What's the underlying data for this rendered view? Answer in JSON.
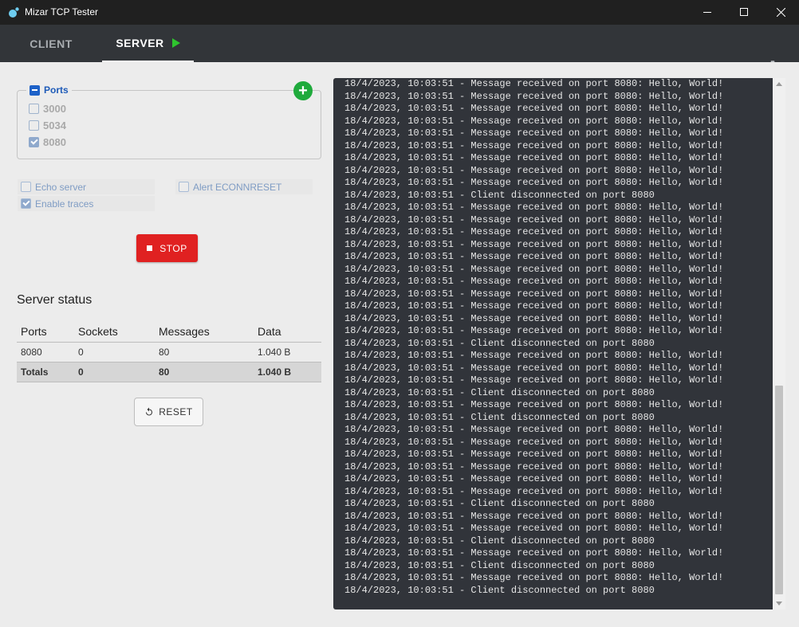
{
  "window": {
    "title": "Mizar TCP Tester"
  },
  "tabs": {
    "client": "CLIENT",
    "server": "SERVER"
  },
  "ports": {
    "legend": "Ports",
    "items": [
      {
        "label": "3000",
        "checked": false
      },
      {
        "label": "5034",
        "checked": false
      },
      {
        "label": "8080",
        "checked": true
      }
    ]
  },
  "options": {
    "echo_server": "Echo server",
    "enable_traces": "Enable traces",
    "alert_econnreset": "Alert ECONNRESET"
  },
  "stop_label": "STOP",
  "status": {
    "title": "Server status",
    "headers": [
      "Ports",
      "Sockets",
      "Messages",
      "Data"
    ],
    "row": [
      "8080",
      "0",
      "80",
      "1.040 B"
    ],
    "totals": [
      "Totals",
      "0",
      "80",
      "1.040 B"
    ]
  },
  "reset_label": "RESET",
  "log": [
    "18/4/2023, 10:03:51 - Message received on port 8080: Hello, World!",
    "18/4/2023, 10:03:51 - Message received on port 8080: Hello, World!",
    "18/4/2023, 10:03:51 - Message received on port 8080: Hello, World!",
    "18/4/2023, 10:03:51 - Message received on port 8080: Hello, World!",
    "18/4/2023, 10:03:51 - Message received on port 8080: Hello, World!",
    "18/4/2023, 10:03:51 - Message received on port 8080: Hello, World!",
    "18/4/2023, 10:03:51 - Message received on port 8080: Hello, World!",
    "18/4/2023, 10:03:51 - Message received on port 8080: Hello, World!",
    "18/4/2023, 10:03:51 - Message received on port 8080: Hello, World!",
    "18/4/2023, 10:03:51 - Client disconnected on port 8080",
    "18/4/2023, 10:03:51 - Message received on port 8080: Hello, World!",
    "18/4/2023, 10:03:51 - Message received on port 8080: Hello, World!",
    "18/4/2023, 10:03:51 - Message received on port 8080: Hello, World!",
    "18/4/2023, 10:03:51 - Message received on port 8080: Hello, World!",
    "18/4/2023, 10:03:51 - Message received on port 8080: Hello, World!",
    "18/4/2023, 10:03:51 - Message received on port 8080: Hello, World!",
    "18/4/2023, 10:03:51 - Message received on port 8080: Hello, World!",
    "18/4/2023, 10:03:51 - Message received on port 8080: Hello, World!",
    "18/4/2023, 10:03:51 - Message received on port 8080: Hello, World!",
    "18/4/2023, 10:03:51 - Message received on port 8080: Hello, World!",
    "18/4/2023, 10:03:51 - Message received on port 8080: Hello, World!",
    "18/4/2023, 10:03:51 - Client disconnected on port 8080",
    "18/4/2023, 10:03:51 - Message received on port 8080: Hello, World!",
    "18/4/2023, 10:03:51 - Message received on port 8080: Hello, World!",
    "18/4/2023, 10:03:51 - Message received on port 8080: Hello, World!",
    "18/4/2023, 10:03:51 - Client disconnected on port 8080",
    "18/4/2023, 10:03:51 - Message received on port 8080: Hello, World!",
    "18/4/2023, 10:03:51 - Client disconnected on port 8080",
    "18/4/2023, 10:03:51 - Message received on port 8080: Hello, World!",
    "18/4/2023, 10:03:51 - Message received on port 8080: Hello, World!",
    "18/4/2023, 10:03:51 - Message received on port 8080: Hello, World!",
    "18/4/2023, 10:03:51 - Message received on port 8080: Hello, World!",
    "18/4/2023, 10:03:51 - Message received on port 8080: Hello, World!",
    "18/4/2023, 10:03:51 - Message received on port 8080: Hello, World!",
    "18/4/2023, 10:03:51 - Client disconnected on port 8080",
    "18/4/2023, 10:03:51 - Message received on port 8080: Hello, World!",
    "18/4/2023, 10:03:51 - Message received on port 8080: Hello, World!",
    "18/4/2023, 10:03:51 - Client disconnected on port 8080",
    "18/4/2023, 10:03:51 - Message received on port 8080: Hello, World!",
    "18/4/2023, 10:03:51 - Client disconnected on port 8080",
    "18/4/2023, 10:03:51 - Message received on port 8080: Hello, World!",
    "18/4/2023, 10:03:51 - Client disconnected on port 8080"
  ],
  "colors": {
    "accent": "#1e62c8",
    "stop": "#e02121",
    "add": "#1faa3c",
    "play": "#2ec42e",
    "log_bg": "#31343a"
  }
}
